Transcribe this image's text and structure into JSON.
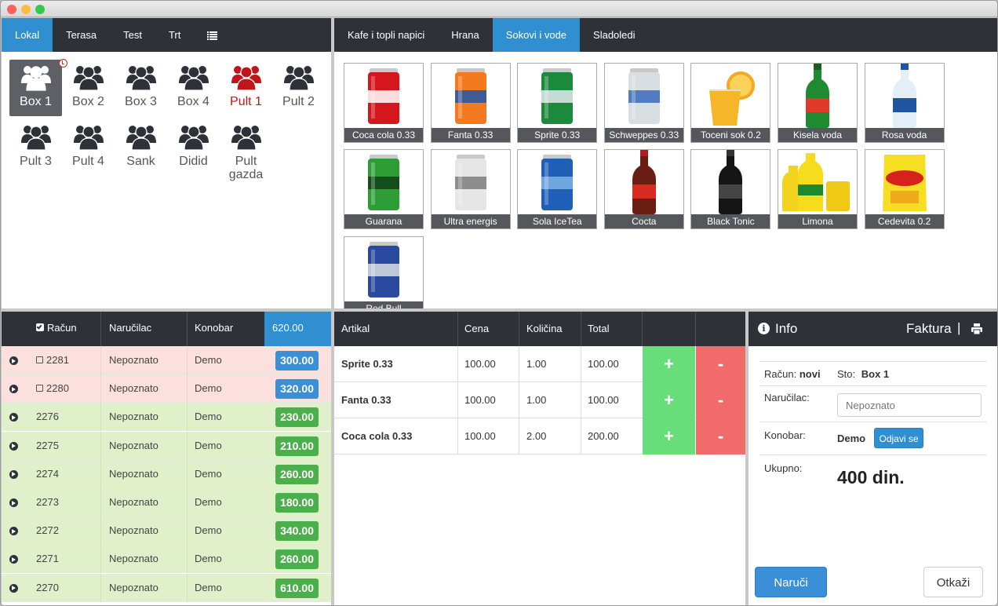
{
  "window": {
    "controls": [
      "close",
      "minimize",
      "zoom"
    ],
    "colors": {
      "close": "#fc605b",
      "minimize": "#fdbc40",
      "zoom": "#34c84a"
    }
  },
  "areas": {
    "tabs": [
      {
        "label": "Lokal",
        "active": true
      },
      {
        "label": "Terasa",
        "active": false
      },
      {
        "label": "Test",
        "active": false
      },
      {
        "label": "Trt",
        "active": false
      }
    ],
    "list_icon": "list-icon",
    "tables": [
      {
        "label": "Box 1",
        "state": "selected"
      },
      {
        "label": "Box 2",
        "state": "timer"
      },
      {
        "label": "Box 3",
        "state": "normal"
      },
      {
        "label": "Box 4",
        "state": "normal"
      },
      {
        "label": "Pult 1",
        "state": "occupied"
      },
      {
        "label": "Pult 2",
        "state": "normal"
      },
      {
        "label": "Pult 3",
        "state": "normal"
      },
      {
        "label": "Pult 4",
        "state": "normal"
      },
      {
        "label": "Sank",
        "state": "normal"
      },
      {
        "label": "Didid",
        "state": "normal"
      },
      {
        "label": "Pult gazda",
        "state": "normal"
      }
    ]
  },
  "categories": {
    "tabs": [
      {
        "label": "Kafe i topli napici",
        "active": false
      },
      {
        "label": "Hrana",
        "active": false
      },
      {
        "label": "Sokovi i vode",
        "active": true
      },
      {
        "label": "Sladoledi",
        "active": false
      }
    ],
    "products": [
      {
        "label": "Coca cola 0.33",
        "icon": "red-can-icon"
      },
      {
        "label": "Fanta 0.33",
        "icon": "orange-can-icon"
      },
      {
        "label": "Sprite 0.33",
        "icon": "green-can-icon"
      },
      {
        "label": "Schweppes 0.33",
        "icon": "silver-can-icon"
      },
      {
        "label": "Toceni sok 0.2",
        "icon": "juice-glass-icon"
      },
      {
        "label": "Kisela voda",
        "icon": "green-bottle-icon"
      },
      {
        "label": "Rosa voda",
        "icon": "water-bottle-icon"
      },
      {
        "label": "Guarana",
        "icon": "guarana-can-icon"
      },
      {
        "label": "Ultra energis",
        "icon": "white-can-icon"
      },
      {
        "label": "Sola IceTea",
        "icon": "blue-can-icon"
      },
      {
        "label": "Cocta",
        "icon": "brown-bottle-icon"
      },
      {
        "label": "Black Tonic",
        "icon": "black-bottle-icon"
      },
      {
        "label": "Limona",
        "icon": "yellow-bottles-icon"
      },
      {
        "label": "Cedevita 0.2",
        "icon": "yellow-bag-icon"
      },
      {
        "label": "Red Bull",
        "icon": "redbull-can-icon"
      }
    ]
  },
  "bills": {
    "headers": {
      "racun": "Račun",
      "narucilac": "Naručilac",
      "konobar": "Konobar",
      "total": "620.00"
    },
    "rows": [
      {
        "number": "2281",
        "narucilac": "Nepoznato",
        "konobar": "Demo",
        "amount": "300.00",
        "status": "open"
      },
      {
        "number": "2280",
        "narucilac": "Nepoznato",
        "konobar": "Demo",
        "amount": "320.00",
        "status": "open"
      },
      {
        "number": "2276",
        "narucilac": "Nepoznato",
        "konobar": "Demo",
        "amount": "230.00",
        "status": "paid"
      },
      {
        "number": "2275",
        "narucilac": "Nepoznato",
        "konobar": "Demo",
        "amount": "210.00",
        "status": "paid"
      },
      {
        "number": "2274",
        "narucilac": "Nepoznato",
        "konobar": "Demo",
        "amount": "260.00",
        "status": "paid"
      },
      {
        "number": "2273",
        "narucilac": "Nepoznato",
        "konobar": "Demo",
        "amount": "180.00",
        "status": "paid"
      },
      {
        "number": "2272",
        "narucilac": "Nepoznato",
        "konobar": "Demo",
        "amount": "340.00",
        "status": "paid"
      },
      {
        "number": "2271",
        "narucilac": "Nepoznato",
        "konobar": "Demo",
        "amount": "260.00",
        "status": "paid"
      },
      {
        "number": "2270",
        "narucilac": "Nepoznato",
        "konobar": "Demo",
        "amount": "610.00",
        "status": "paid"
      }
    ]
  },
  "order": {
    "headers": {
      "artikal": "Artikal",
      "cena": "Cena",
      "kolicina": "Količina",
      "total": "Total"
    },
    "plus_label": "+",
    "minus_label": "-",
    "items": [
      {
        "artikal": "Sprite 0.33",
        "cena": "100.00",
        "kolicina": "1.00",
        "total": "100.00"
      },
      {
        "artikal": "Fanta 0.33",
        "cena": "100.00",
        "kolicina": "1.00",
        "total": "100.00"
      },
      {
        "artikal": "Coca cola 0.33",
        "cena": "100.00",
        "kolicina": "2.00",
        "total": "200.00"
      }
    ]
  },
  "info": {
    "title": "Info",
    "faktura": "Faktura",
    "separator": "|",
    "racun_label": "Račun:",
    "racun_value": "novi",
    "sto_label": "Sto:",
    "sto_value": "Box 1",
    "narucilac_label": "Naručilac:",
    "narucilac_value": "Nepoznato",
    "konobar_label": "Konobar:",
    "konobar_value": "Demo",
    "odjavi": "Odjavi se",
    "ukupno_label": "Ukupno:",
    "ukupno_value": "400 din.",
    "naruci": "Naruči",
    "otkazi": "Otkaži"
  },
  "colors": {
    "accent": "#2f8fd0",
    "header_dark": "#2e3138",
    "open_row": "#fbe0dd",
    "paid_row": "#dff0cb",
    "paid_badge": "#4bb04b",
    "plus": "#67de79",
    "minus": "#f26b6b",
    "occupied": "#c0161b"
  }
}
